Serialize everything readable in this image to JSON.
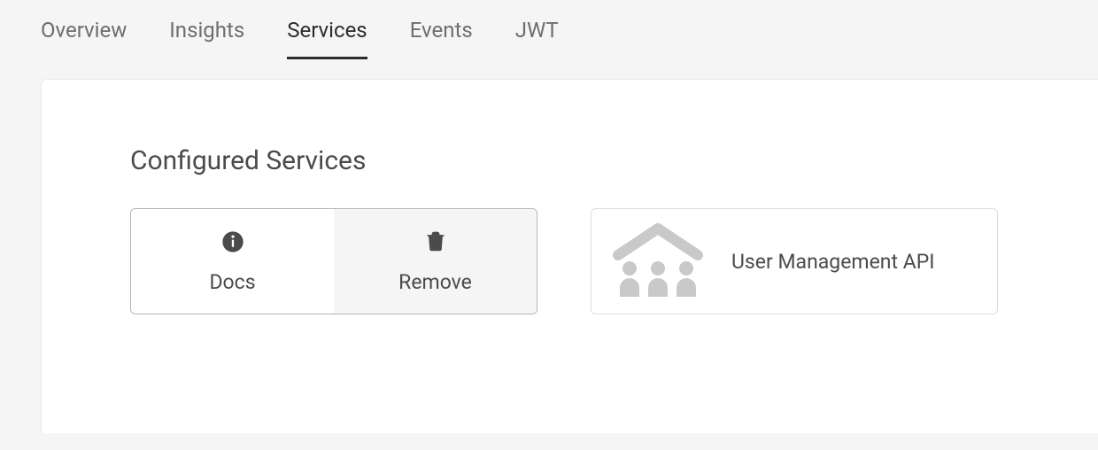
{
  "tabs": [
    {
      "label": "Overview",
      "active": false
    },
    {
      "label": "Insights",
      "active": false
    },
    {
      "label": "Services",
      "active": true
    },
    {
      "label": "Events",
      "active": false
    },
    {
      "label": "JWT",
      "active": false
    }
  ],
  "section": {
    "title": "Configured Services"
  },
  "actions": {
    "docs_label": "Docs",
    "remove_label": "Remove"
  },
  "services": [
    {
      "name": "User Management API",
      "icon": "user-management-icon"
    }
  ]
}
